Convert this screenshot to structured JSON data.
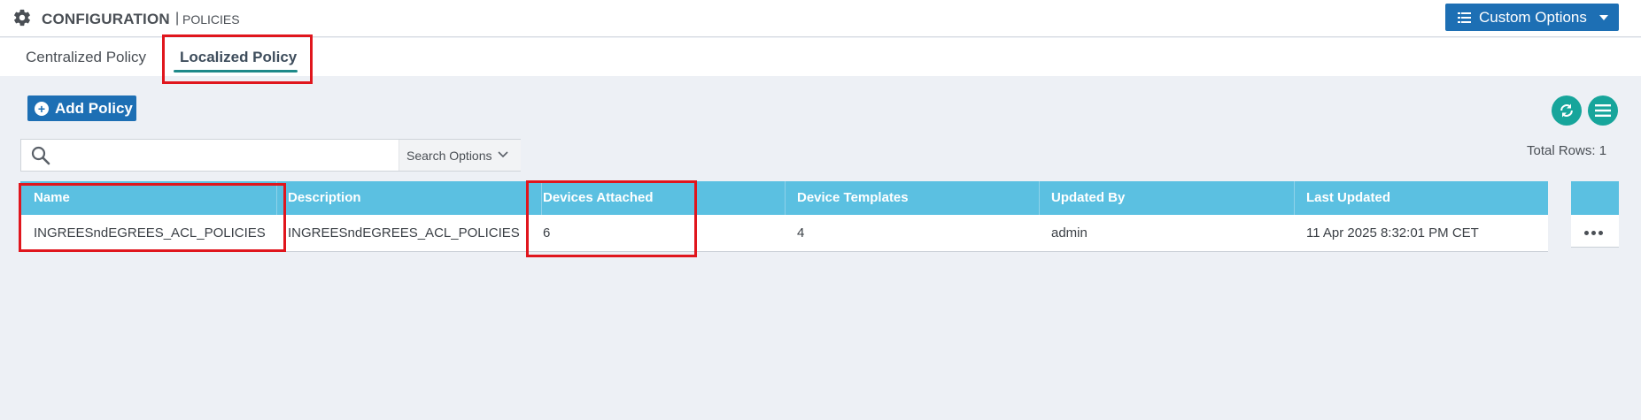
{
  "header": {
    "title": "CONFIGURATION",
    "separator": "|",
    "subtitle": "POLICIES",
    "custom_options_label": "Custom Options"
  },
  "tabs": [
    {
      "label": "Centralized Policy",
      "active": false
    },
    {
      "label": "Localized Policy",
      "active": true
    }
  ],
  "toolbar": {
    "add_policy_label": "Add Policy"
  },
  "search": {
    "placeholder": "",
    "options_label": "Search Options"
  },
  "total_rows": "Total Rows: 1",
  "table": {
    "columns": [
      "Name",
      "Description",
      "Devices Attached",
      "Device Templates",
      "Updated By",
      "Last Updated"
    ],
    "rows": [
      {
        "name": "INGREESndEGREES_ACL_POLICIES",
        "description": "INGREESndEGREES_ACL_POLICIES",
        "devices_attached": "6",
        "device_templates": "4",
        "updated_by": "admin",
        "last_updated": "11 Apr 2025 8:32:01 PM CET"
      }
    ]
  },
  "colors": {
    "primary": "#1d6fb4",
    "teal": "#17a59b",
    "table_header": "#5bc0e1",
    "annotation": "#e0161d"
  },
  "icons": [
    "gear-icon",
    "list-icon",
    "plus-circle-icon",
    "refresh-icon",
    "hamburger-icon",
    "search-icon",
    "chevron-down-icon",
    "more-dots-icon"
  ]
}
